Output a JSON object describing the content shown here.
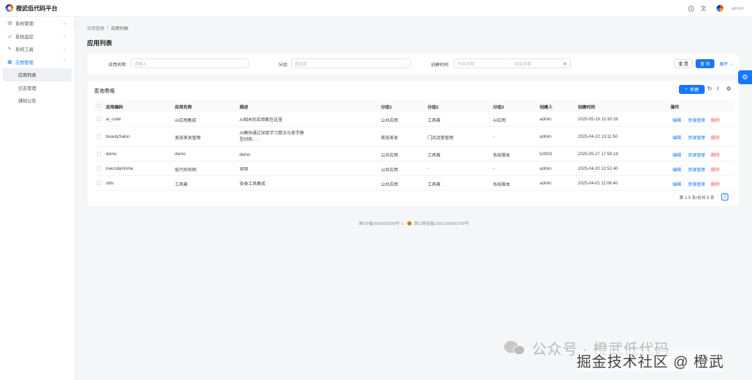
{
  "app": {
    "title": "橙武低代码平台"
  },
  "header": {
    "user": "admin"
  },
  "sidebar": {
    "items": [
      {
        "label": "系统管理"
      },
      {
        "label": "系统监控"
      },
      {
        "label": "系统工具"
      },
      {
        "label": "应用管理"
      }
    ],
    "sub_items": [
      {
        "label": "应用列表"
      },
      {
        "label": "日志管理"
      },
      {
        "label": "通知公告"
      }
    ]
  },
  "breadcrumb": {
    "parent": "应用管理",
    "separator": "/",
    "current": "应用列表"
  },
  "page": {
    "title": "应用列表"
  },
  "search": {
    "name_label": "应用名称:",
    "name_placeholder": "请输入",
    "category_label": "分组:",
    "category_placeholder": "请选择",
    "created_label": "创建时间:",
    "start_placeholder": "开始日期",
    "end_placeholder": "结束日期",
    "reset_label": "重 置",
    "query_label": "查 询",
    "expand_label": "展开"
  },
  "table": {
    "title": "查询表格",
    "new_label": "新建",
    "columns": [
      "应用编码",
      "应用名称",
      "描述",
      "分组1",
      "分组2",
      "分组3",
      "创建人",
      "创建时间",
      "操作"
    ],
    "rows": [
      {
        "code": "ai_code",
        "name": "AI应用集成",
        "desc": "AI相关的应用都在这里",
        "g1": "公共应用",
        "g2": "工具箱",
        "g3": "AI应用",
        "creator": "admin",
        "time": "2025-05-19 12:30:18"
      },
      {
        "code": "beautySalon",
        "name": "美容美发管理",
        "desc": "AI模块通过深度学习算法与美学模型训练、..",
        "g1": "美容美发",
        "g2": "门店运营管理",
        "g3": "-",
        "creator": "admin",
        "time": "2025-04-22 13:11:50"
      },
      {
        "code": "demo",
        "name": "demo",
        "desc": "demo",
        "g1": "公共应用",
        "g2": "工具箱",
        "g3": "系统脚本",
        "creator": "lc0001",
        "time": "2025-05-27 17:58:14"
      },
      {
        "code": "lowcodeHome",
        "name": "低代码官网",
        "desc": "官网",
        "g1": "公共应用",
        "g2": "-",
        "g3": "-",
        "creator": "admin",
        "time": "2025-04-20 12:51:40"
      },
      {
        "code": "utils",
        "name": "工具箱",
        "desc": "各类工具集成",
        "g1": "公共应用",
        "g2": "工具箱",
        "g3": "系统脚本",
        "creator": "admin",
        "time": "2025-04-01 11:06:40"
      }
    ],
    "actions": {
      "edit": "编辑",
      "resource": "资源管理",
      "delete": "删除"
    },
    "pagination": {
      "summary": "第 1-5 条/总共 5 条",
      "current": "1"
    }
  },
  "footer": {
    "icp": "津ICP备2025033293号-1",
    "police": "津公网安备12011102001739号"
  },
  "watermark": {
    "account": "公众号 · 橙武低代码",
    "community": "掘金技术社区 @ 橙武"
  },
  "colors": {
    "primary": "#1677ff",
    "danger": "#ff4d4f"
  }
}
